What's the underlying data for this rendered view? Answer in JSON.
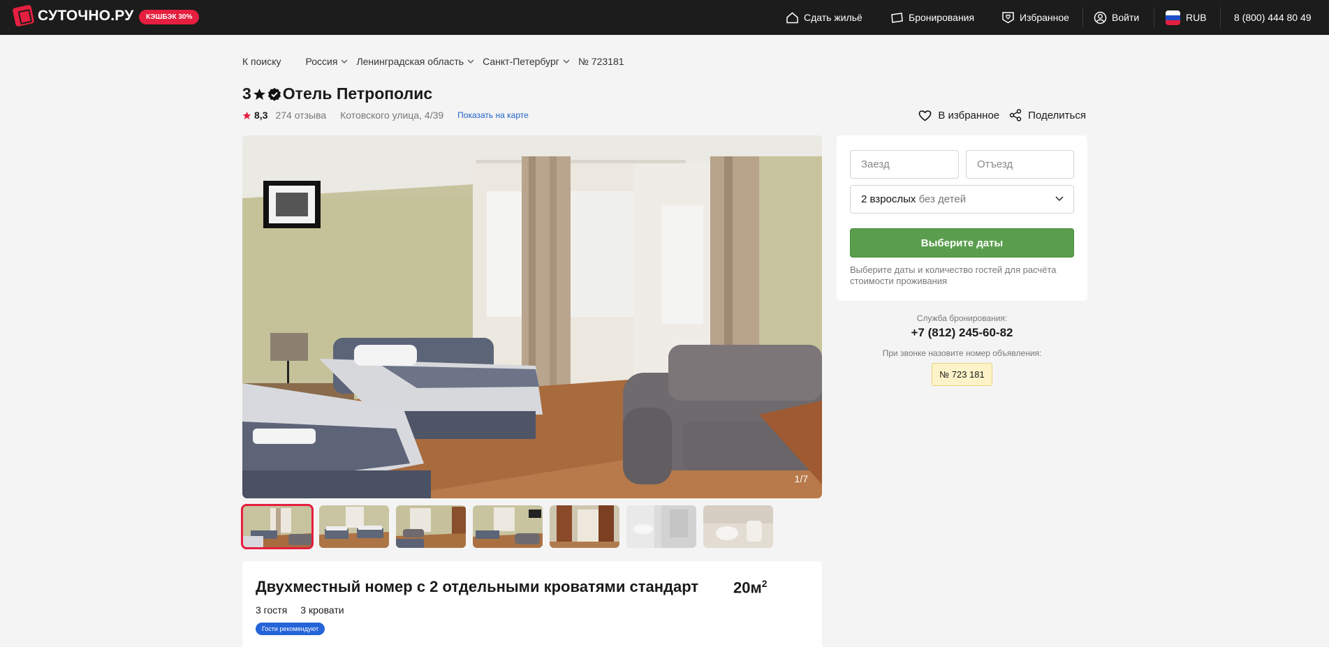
{
  "header": {
    "logo": "СУТОЧНО.РУ",
    "cashback": "КЭШБЭК 30%",
    "nav": {
      "rent_out": "Сдать жильё",
      "bookings": "Бронирования",
      "favorites": "Избранное",
      "login": "Войти",
      "currency": "RUB",
      "phone": "8 (800) 444 80 49"
    }
  },
  "breadcrumb": {
    "back": "К поиску",
    "items": [
      "Россия",
      "Ленинградская область",
      "Санкт-Петербург"
    ],
    "listing_no": "№ 723181"
  },
  "listing": {
    "stars": "3",
    "title": "Отель Петрополис",
    "rating": "8,3",
    "reviews": "274 отзыва",
    "address": "Котовского улица, 4/39",
    "map_link": "Показать на карте",
    "favorite": "В избранное",
    "share": "Поделиться"
  },
  "gallery": {
    "counter": "1/7"
  },
  "booking": {
    "checkin_placeholder": "Заезд",
    "checkout_placeholder": "Отъезд",
    "guests_main": "2 взрослых",
    "guests_sub": "без детей",
    "cta": "Выберите даты",
    "hint": "Выберите даты и количество гостей для расчёта стоимости проживания"
  },
  "support": {
    "label": "Служба бронирования:",
    "phone": "+7 (812) 245-60-82",
    "call_hint": "При звонке назовите номер объявления:",
    "listing_no": "№ 723 181"
  },
  "room": {
    "title": "Двухместный номер с 2 отдельными кроватями стандарт",
    "area": "20м",
    "area_sup": "2",
    "guests": "3 гостя",
    "beds": "3 кровати",
    "badge": "Гости рекомендуют"
  },
  "colors": {
    "brand": "#e51f3f",
    "cta": "#5a9e4d",
    "link": "#2062c9"
  }
}
